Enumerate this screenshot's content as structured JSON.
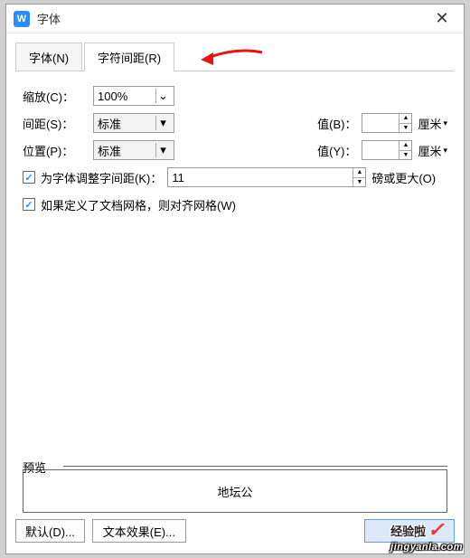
{
  "window": {
    "app_icon_letter": "W",
    "title": "字体",
    "close_glyph": "✕"
  },
  "tabs": {
    "items": [
      {
        "label": "字体(N)"
      },
      {
        "label": "字符间距(R)"
      }
    ],
    "active_index": 1
  },
  "form": {
    "scale": {
      "label": "缩放(C)：",
      "value": "100%"
    },
    "spacing": {
      "label": "间距(S)：",
      "value": "标准",
      "value_label": "值(B)：",
      "value_input": "",
      "unit": "厘米",
      "unit_chevron": "▾"
    },
    "position": {
      "label": "位置(P)：",
      "value": "标准",
      "value_label": "值(Y)：",
      "value_input": "",
      "unit": "厘米",
      "unit_chevron": "▾"
    },
    "kerning": {
      "checked": true,
      "label": "为字体调整字间距(K)：",
      "value": "11",
      "suffix": "磅或更大(O)"
    },
    "snap": {
      "checked": true,
      "label": "如果定义了文档网格，则对齐网格(W)"
    }
  },
  "preview": {
    "label": "预览",
    "text": "地坛公"
  },
  "footer": {
    "default_btn": "默认(D)...",
    "text_effect_btn": "文本效果(E)...",
    "ok_btn": "确定"
  },
  "watermark": {
    "zh": "经验啦",
    "check": "✓",
    "en": "jingyanla.com"
  },
  "glyphs": {
    "chevron_down": "⌄",
    "tri_down": "▾",
    "tri_up_sm": "▲",
    "tri_down_sm": "▼",
    "check": "✓"
  }
}
